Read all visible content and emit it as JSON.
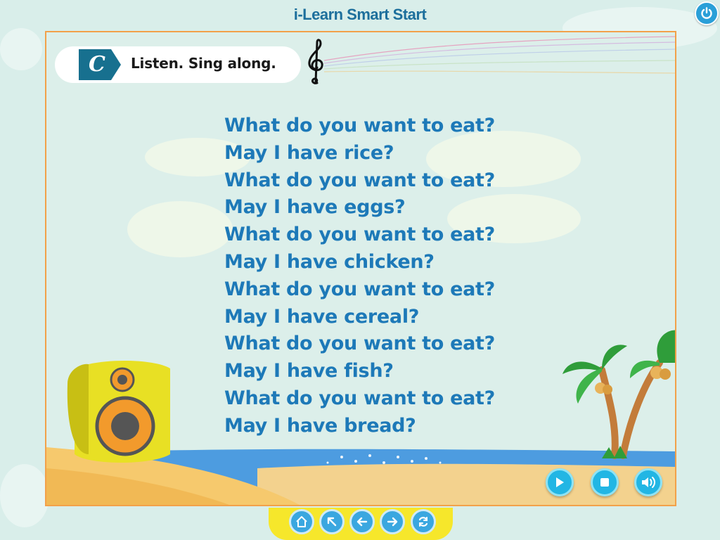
{
  "app": {
    "title": "i-Learn Smart Start"
  },
  "activity": {
    "badge_letter": "C",
    "instruction": "Listen. Sing along."
  },
  "lyrics": [
    "What do you want to eat?",
    "May I have rice?",
    "What do you want to eat?",
    "May I have eggs?",
    "What do you want to eat?",
    "May I have chicken?",
    "What do you want to eat?",
    "May I have cereal?",
    "What do you want to eat?",
    "May I have fish?",
    "What do you want to eat?",
    "May I have bread?"
  ],
  "media_controls": [
    {
      "name": "play-button",
      "icon": "play-icon"
    },
    {
      "name": "stop-button",
      "icon": "stop-icon"
    },
    {
      "name": "volume-button",
      "icon": "speaker-icon"
    }
  ],
  "navigation": [
    {
      "name": "home-button",
      "icon": "home-icon"
    },
    {
      "name": "back-to-menu-button",
      "icon": "arrow-up-left-icon"
    },
    {
      "name": "previous-button",
      "icon": "arrow-left-icon"
    },
    {
      "name": "next-button",
      "icon": "arrow-right-icon"
    },
    {
      "name": "replay-button",
      "icon": "refresh-icon"
    }
  ],
  "colors": {
    "title": "#1d6f9c",
    "lyrics": "#1d79b8",
    "panel_border": "#f2a14a",
    "badge": "#17708f",
    "button": "#22b6e4",
    "nav_tray": "#f6e72b"
  }
}
